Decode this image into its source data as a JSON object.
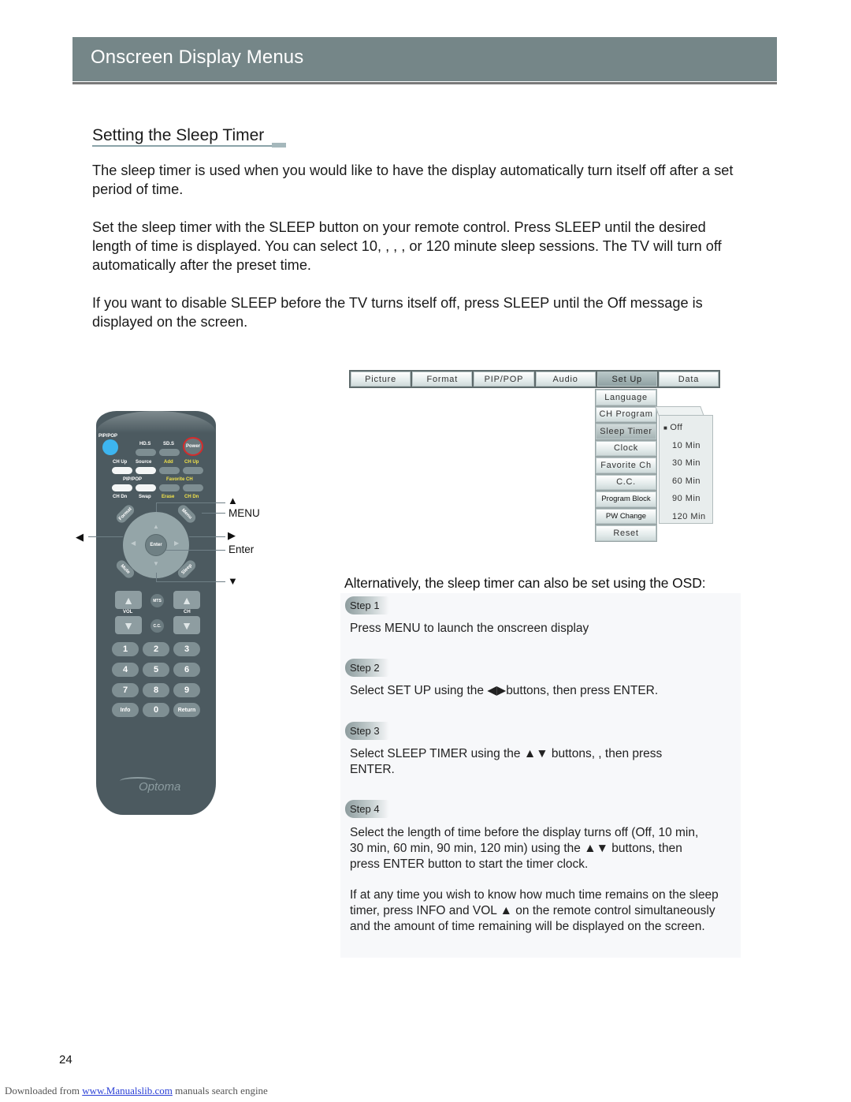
{
  "header": {
    "title": "Onscreen Display Menus"
  },
  "section": {
    "title": "Setting the Sleep Timer",
    "paragraphs": [
      "The sleep timer is used when you would like to have the display automatically turn itself off after a set period of time.",
      "Set the sleep timer with the SLEEP button on your remote control. Press SLEEP until the desired length of time is displayed. You can select 10, , , , or 120 minute sleep sessions. The TV will turn off automatically after the preset time.",
      "If you want to disable SLEEP before the TV turns itself off, press SLEEP until the Off message is displayed on the screen."
    ]
  },
  "osd": {
    "tabs": [
      "Picture",
      "Format",
      "PIP/POP",
      "Audio",
      "Set Up",
      "Data"
    ],
    "active_tab": "Set Up",
    "setup_items": [
      "Language",
      "CH Program",
      "Sleep Timer",
      "Clock",
      "Favorite Ch",
      "C.C.",
      "Program Block",
      "PW Change",
      "Reset"
    ],
    "active_item": "Sleep Timer",
    "sleep_options": [
      "Off",
      "10 Min",
      "30 Min",
      "60 Min",
      "90 Min",
      "120 Min"
    ],
    "selected_option": "Off",
    "selected_marker": "■"
  },
  "remote": {
    "labels": {
      "pip_pop_top": "PIP/POP",
      "hds": "HD.S",
      "sds": "SD.S",
      "power": "Power",
      "ch_up_1": "CH Up",
      "source": "Source",
      "add": "Add",
      "ch_up_2": "CH Up",
      "pip_pop_mid": "PIP/POP",
      "favorite_ch": "Favorite CH",
      "ch_dn_1": "CH Dn",
      "swap": "Swap",
      "erase": "Erase",
      "ch_dn_2": "CH Dn",
      "format": "Format",
      "menu": "Menu",
      "enter": "Enter",
      "mute": "Mute",
      "sleep": "Sleep",
      "mts": "MTS",
      "cc": "C.C.",
      "vol": "VOL",
      "ch": "CH",
      "info": "Info",
      "return": "Return",
      "brand": "Optoma"
    },
    "numbers": [
      "1",
      "2",
      "3",
      "4",
      "5",
      "6",
      "7",
      "8",
      "9"
    ],
    "zero": "0",
    "callouts": {
      "up": "▲",
      "menu": "MENU",
      "right": "▶",
      "enter": "Enter",
      "down": "▼",
      "left": "◀"
    },
    "colors": {
      "body": "#4c5a60",
      "pip_button": "#3db5f0",
      "power_ring": "#d62b2b",
      "yellow_label": "#f0e14a"
    }
  },
  "osd_steps": {
    "heading": "Alternatively, the sleep timer can also be set using the OSD:",
    "steps": [
      {
        "label": "Step 1",
        "text": "Press MENU to launch the onscreen display"
      },
      {
        "label": "Step 2",
        "text_before": "Select SET UP using the ",
        "arrows": "◀▶",
        "text_after": "buttons, then press ENTER."
      },
      {
        "label": "Step 3",
        "text_before": "Select SLEEP TIMER using the ",
        "arrows": "▲▼",
        "text_after": " buttons, , then press ENTER."
      },
      {
        "label": "Step 4",
        "text_before": "Select the length of time before the display turns off (Off, 10 min, 30 min, 60 min, 90 min, 120 min) using the ",
        "arrows": "▲▼",
        "text_after": " buttons, then press ENTER button to start the timer clock."
      }
    ],
    "note_before": "If at any time you wish to know how much time remains on the sleep timer, press INFO and VOL ",
    "note_arrow": "▲",
    "note_after": " on the remote control simultaneously and the amount of time remaining will be displayed on the screen."
  },
  "footer": {
    "page_number": "24",
    "downloaded_from": "Downloaded from ",
    "link_text": "www.Manualslib.com",
    "suffix": " manuals search engine"
  }
}
